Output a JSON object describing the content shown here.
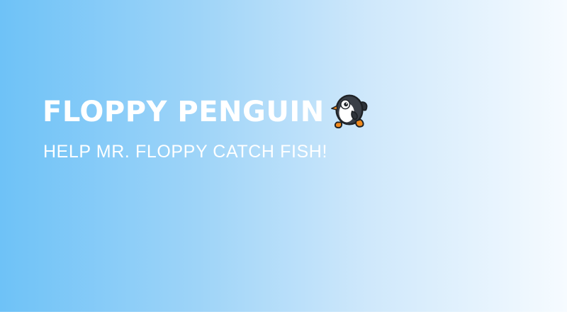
{
  "game": {
    "title": "FLOPPY PENGUIN",
    "subtitle": "HELP MR. FLOPPY CATCH FISH!",
    "mascot_icon": "penguin-icon"
  },
  "colors": {
    "background_start": "#6ec2f7",
    "background_end": "#f6fbff",
    "text": "#ffffff",
    "penguin_body": "#3a3f47",
    "penguin_feet": "#f28a1c"
  }
}
